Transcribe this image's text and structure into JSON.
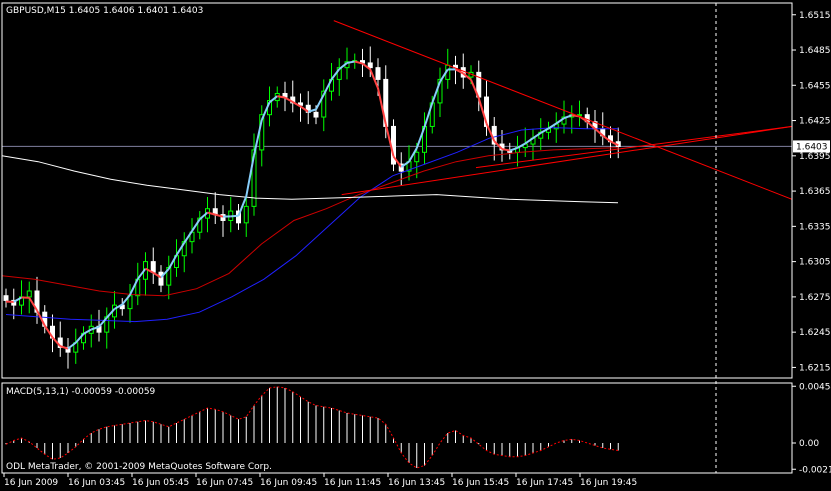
{
  "header": {
    "symbol_line": "GBPUSD,M15  1.6405 1.6406 1.6401 1.6403"
  },
  "price_axis": {
    "ticks": [
      "1.6515",
      "1.6485",
      "1.6455",
      "1.6425",
      "1.6395",
      "1.6365",
      "1.6335",
      "1.6305",
      "1.6275",
      "1.6245",
      "1.6215"
    ],
    "current_price_label": "1.6403"
  },
  "time_axis": {
    "ticks": [
      "16 Jun 2009",
      "16 Jun 03:45",
      "16 Jun 05:45",
      "16 Jun 07:45",
      "16 Jun 09:45",
      "16 Jun 11:45",
      "16 Jun 13:45",
      "16 Jun 15:45",
      "16 Jun 17:45",
      "16 Jun 19:45"
    ]
  },
  "macd_panel": {
    "title": "MACD(5,13,1) -0.00059 -0.00059",
    "ticks": [
      "0.00454",
      "0.00",
      "-0.0021"
    ]
  },
  "footer": {
    "copyright": "ODL MetaTrader, © 2001-2009 MetaQuotes Software Corp."
  },
  "colors": {
    "background": "#000000",
    "foreground": "#ffffff",
    "candle_up": "#00ff00",
    "candle_down": "#ffffff",
    "ma_fast": "#87cefa",
    "ma_fast_down": "#ff4040",
    "ma_mid": "#2020ff",
    "ma_slow": "#cc0000",
    "ma_long": "#ffffff",
    "trendline": "#ff0000",
    "macd_bar": "#ffffff",
    "macd_signal": "#ff0000",
    "bid_line": "#8080a0"
  },
  "chart_data": {
    "type": "candlestick",
    "symbol": "GBPUSD",
    "timeframe": "M15",
    "ylim": [
      1.6206,
      1.6525
    ],
    "y_ticks": [
      1.6515,
      1.6485,
      1.6455,
      1.6425,
      1.6395,
      1.6365,
      1.6335,
      1.6305,
      1.6275,
      1.6245,
      1.6215
    ],
    "last_price": 1.6403,
    "close": [
      1.6272,
      1.6268,
      1.6275,
      1.628,
      1.6262,
      1.625,
      1.624,
      1.6232,
      1.6228,
      1.6236,
      1.6244,
      1.625,
      1.6245,
      1.6258,
      1.6268,
      1.6265,
      1.6276,
      1.629,
      1.6305,
      1.6296,
      1.6285,
      1.63,
      1.631,
      1.6322,
      1.633,
      1.6342,
      1.635,
      1.6345,
      1.634,
      1.6348,
      1.6338,
      1.6352,
      1.64,
      1.643,
      1.6442,
      1.6448,
      1.6445,
      1.644,
      1.6438,
      1.6432,
      1.6428,
      1.645,
      1.646,
      1.647,
      1.6475,
      1.6476,
      1.6474,
      1.647,
      1.646,
      1.642,
      1.6388,
      1.6382,
      1.639,
      1.6398,
      1.642,
      1.644,
      1.646,
      1.6472,
      1.647,
      1.6462,
      1.6466,
      1.6445,
      1.642,
      1.6405,
      1.64,
      1.6398,
      1.6402,
      1.6405,
      1.641,
      1.6415,
      1.6418,
      1.6422,
      1.6428,
      1.643,
      1.643,
      1.6424,
      1.6418,
      1.6412,
      1.6407,
      1.6403
    ],
    "ma_blue": [
      1.626,
      1.6258,
      1.6256,
      1.6255,
      1.6254,
      1.6256,
      1.6262,
      1.6275,
      1.629,
      1.631,
      1.6335,
      1.636,
      1.6378,
      1.6388,
      1.6398,
      1.641,
      1.6417,
      1.6419,
      1.6418,
      1.6418
    ],
    "ma_red": [
      1.6293,
      1.629,
      1.6285,
      1.628,
      1.6277,
      1.6276,
      1.6282,
      1.6295,
      1.632,
      1.634,
      1.635,
      1.6362,
      1.6372,
      1.6382,
      1.639,
      1.6395,
      1.6398,
      1.64,
      1.6401,
      1.6402
    ],
    "ma_white": [
      1.6395,
      1.639,
      1.6382,
      1.6375,
      1.637,
      1.6366,
      1.6362,
      1.6359,
      1.6358,
      1.6359,
      1.636,
      1.6361,
      1.6362,
      1.636,
      1.6358,
      1.6357,
      1.6356,
      1.6355
    ],
    "trendlines": [
      {
        "from": [
          1.651,
          0.42
        ],
        "to": [
          1.6358,
          1.0
        ]
      },
      {
        "from": [
          1.6362,
          0.43
        ],
        "to": [
          1.642,
          1.0
        ]
      },
      {
        "from": [
          1.6385,
          0.6
        ],
        "to": [
          1.642,
          1.0
        ]
      }
    ],
    "macd": {
      "params": "5,13,1",
      "ylim": [
        -0.0024,
        0.0048
      ],
      "values": [
        -0.0001,
        0.0002,
        0.0004,
        0.0001,
        -0.0004,
        -0.0009,
        -0.0013,
        -0.0012,
        -0.0008,
        -0.0003,
        0.0003,
        0.0008,
        0.0011,
        0.0013,
        0.0014,
        0.0015,
        0.0016,
        0.0017,
        0.0018,
        0.0017,
        0.0015,
        0.0013,
        0.0016,
        0.0019,
        0.0022,
        0.0025,
        0.0028,
        0.0027,
        0.0025,
        0.0022,
        0.0019,
        0.0021,
        0.003,
        0.0038,
        0.0044,
        0.0045,
        0.0044,
        0.0041,
        0.0037,
        0.0033,
        0.003,
        0.0029,
        0.0028,
        0.0026,
        0.0024,
        0.0023,
        0.0022,
        0.0021,
        0.002,
        0.0015,
        0.0004,
        -0.0008,
        -0.0016,
        -0.002,
        -0.0018,
        -0.001,
        0.0,
        0.0008,
        0.001,
        0.0006,
        0.0004,
        -0.0001,
        -0.0006,
        -0.0009,
        -0.001,
        -0.0011,
        -0.0011,
        -0.001,
        -0.0008,
        -0.0006,
        -0.0003,
        0.0,
        0.0002,
        0.0003,
        0.0002,
        0.0,
        -0.0002,
        -0.0004,
        -0.0005,
        -0.0006
      ]
    }
  }
}
